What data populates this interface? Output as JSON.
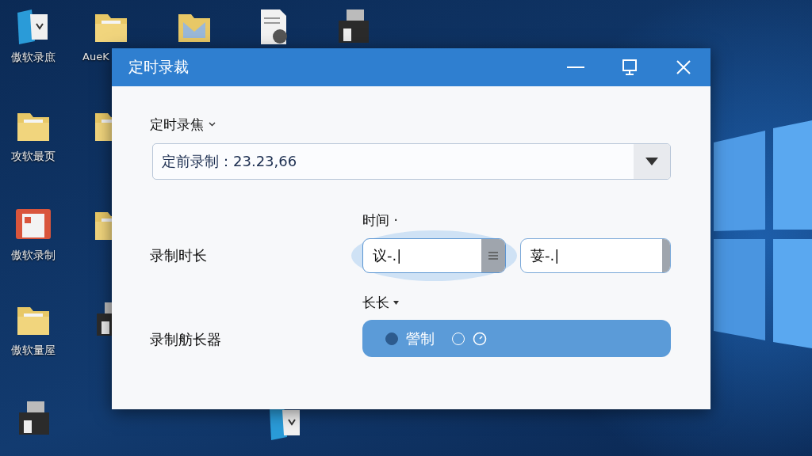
{
  "desktop": {
    "icons": [
      {
        "kind": "app",
        "label": "傲软录庶"
      },
      {
        "kind": "folder",
        "label": "AueK"
      },
      {
        "kind": "mailfolder"
      },
      {
        "kind": "document"
      },
      {
        "kind": "printer"
      },
      {
        "kind": "folder",
        "label": "攻软最页"
      },
      {
        "kind": "folder"
      },
      {
        "kind": "reddoc",
        "label": "傲软录制"
      },
      {
        "kind": "folder"
      },
      {
        "kind": "folder",
        "label": "傲软量屋"
      },
      {
        "kind": "printer"
      },
      {
        "kind": "printer"
      },
      {
        "kind": "app"
      }
    ]
  },
  "window": {
    "title": "定时录裁"
  },
  "section": {
    "label": "定时录焦"
  },
  "dropdown": {
    "value": "定前录制：23.23,66"
  },
  "duration": {
    "label": "录制时长",
    "heading": "时间 ·",
    "fields": [
      {
        "value": "议-.|",
        "focused": true
      },
      {
        "value": "荽-.|",
        "focused": false
      }
    ]
  },
  "mode": {
    "label": "录制舫长器",
    "heading": "长长",
    "options": [
      {
        "label": "謍制",
        "selected": true
      },
      {
        "selected": false
      }
    ]
  }
}
